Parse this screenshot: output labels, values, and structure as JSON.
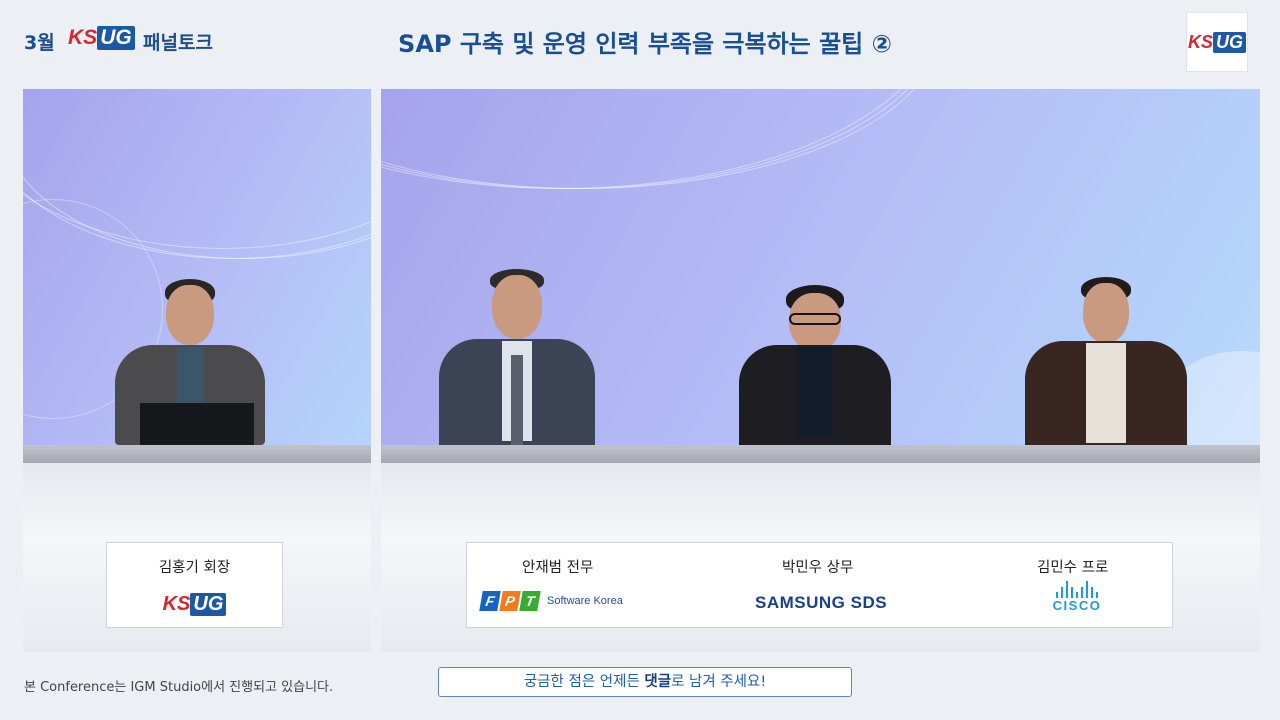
{
  "header": {
    "month": "3월",
    "brand": {
      "ks": "KS",
      "ug": "UG"
    },
    "panel_label": "패널토크",
    "title": "SAP 구축 및 운영 인력 부족을 극복하는 꿀팁 ②"
  },
  "moderator": {
    "name": "김홍기 회장"
  },
  "panelists": [
    {
      "name": "안재범 전무",
      "logo_text": "Software Korea",
      "logo_letters": [
        "F",
        "P",
        "T"
      ]
    },
    {
      "name": "박민우 상무",
      "logo_text": "SAMSUNG SDS"
    },
    {
      "name": "김민수 프로",
      "logo_text": "CISCO"
    }
  ],
  "footer": {
    "note": "본 Conference는 IGM Studio에서 진행되고 있습니다.",
    "comment_prefix": "궁금한 점은 언제든 ",
    "comment_bold": "댓글",
    "comment_suffix": "로 남겨 주세요!"
  },
  "colors": {
    "brand_blue": "#1c58a8",
    "brand_red": "#d7262d",
    "title_blue": "#184e96",
    "fpt_blue": "#1565c0",
    "fpt_orange": "#f47a20",
    "fpt_green": "#3aaa35",
    "cisco_blue": "#1b9bd7"
  }
}
